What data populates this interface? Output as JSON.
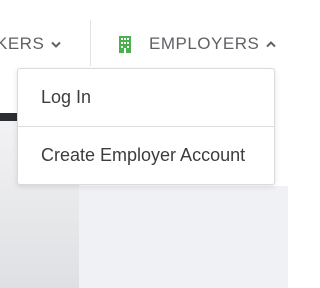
{
  "nav": {
    "seekers_label": "KERS",
    "employers_label": "EMPLOYERS",
    "employers_icon_color": "#4caf50"
  },
  "dropdown": {
    "items": [
      {
        "label": "Log In"
      },
      {
        "label": "Create Employer Account"
      }
    ]
  }
}
